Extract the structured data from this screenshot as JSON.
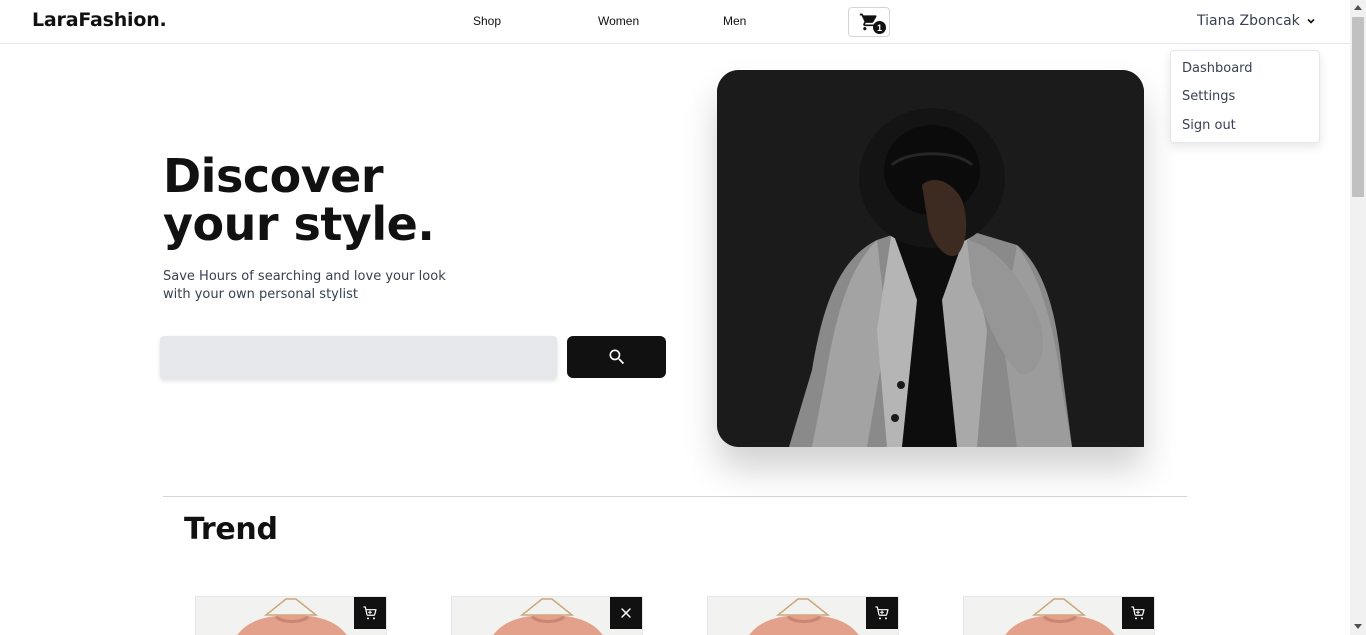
{
  "navbar": {
    "logo": "LaraFashion.",
    "links": [
      {
        "label": "Shop"
      },
      {
        "label": "Women"
      },
      {
        "label": "Men"
      }
    ],
    "cart_count": "1",
    "user_name": "Tiana Zboncak"
  },
  "user_dropdown": {
    "items": [
      {
        "label": "Dashboard"
      },
      {
        "label": "Settings"
      },
      {
        "label": "Sign out"
      }
    ]
  },
  "hero": {
    "title_line1": "Discover",
    "title_line2": "your style.",
    "subtitle": "Save Hours of searching and love your look with your own personal stylist",
    "search_value": "",
    "search_placeholder": ""
  },
  "trend": {
    "title": "Trend",
    "products": [
      {
        "action": "cart-icon"
      },
      {
        "action": "close-icon"
      },
      {
        "action": "cart-icon"
      },
      {
        "action": "cart-icon"
      }
    ]
  },
  "colors": {
    "primary": "#111111",
    "input_bg": "#e5e7eb",
    "text_muted": "#374151",
    "border": "#e5e7eb"
  }
}
